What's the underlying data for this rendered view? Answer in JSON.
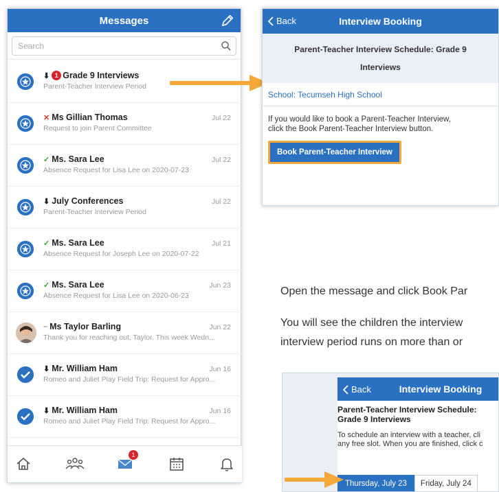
{
  "messages_screen": {
    "title": "Messages",
    "search_placeholder": "Search",
    "items": [
      {
        "prefix": "⬇",
        "badge": "1",
        "name": "Grade 9 Interviews",
        "preview": "Parent-Teacher Interview Period",
        "date": ""
      },
      {
        "prefix": "✕",
        "badge": "",
        "name": "Ms Gillian Thomas",
        "preview": "Request to join Parent Committee",
        "date": "Jul 22"
      },
      {
        "prefix": "✓",
        "badge": "",
        "name": "Ms. Sara Lee",
        "preview": "Absence Request for Lisa Lee on 2020-07-23",
        "date": "Jul 22"
      },
      {
        "prefix": "⬇",
        "badge": "",
        "name": "July Conferences",
        "preview": "Parent-Teacher Interview Period",
        "date": "Jul 22"
      },
      {
        "prefix": "✓",
        "badge": "",
        "name": "Ms. Sara Lee",
        "preview": "Absence Request for Joseph Lee on 2020-07-22",
        "date": "Jul 21"
      },
      {
        "prefix": "✓",
        "badge": "",
        "name": "Ms. Sara Lee",
        "preview": "Absence Request for Lisa Lee on 2020-06-23",
        "date": "Jun 23"
      },
      {
        "prefix": "–",
        "badge": "",
        "name": "Ms Taylor Barling",
        "preview": "Thank you for reaching out, Taylor. This week Wedn...",
        "date": "Jun 22"
      },
      {
        "prefix": "⬇",
        "badge": "",
        "name": "Mr. William Ham",
        "preview": "Romeo and Juliet Play Field Trip: Request for Appro...",
        "date": "Jun 16"
      },
      {
        "prefix": "⬇",
        "badge": "",
        "name": "Mr. William Ham",
        "preview": "Romeo and Juliet Play Field Trip: Request for Appro...",
        "date": "Jun 16"
      }
    ],
    "tab_badge": "1"
  },
  "booking_screen": {
    "back_label": "Back",
    "title": "Interview Booking",
    "schedule_heading_line1": "Parent-Teacher Interview Schedule: Grade 9",
    "schedule_heading_line2": "Interviews",
    "school_link": "School: Tecumseh High School",
    "instructions_line1": "If you would like to book a Parent-Teacher Interview,",
    "instructions_line2": "click the Book Parent-Teacher Interview button.",
    "book_button": "Book Parent-Teacher Interview"
  },
  "body_text": {
    "line1": "Open the message and click Book Par",
    "line2": "You will see the children the interview",
    "line3": "interview period runs on more than or"
  },
  "schedule_screen": {
    "back_label": "Back",
    "title": "Interview Booking",
    "heading_line1": "Parent-Teacher Interview Schedule:",
    "heading_line2": "Grade 9 Interviews",
    "desc_line1": "To schedule an interview with a teacher, cli",
    "desc_line2": "any free slot. When you are finished, click c",
    "day1": "Thursday, July 23",
    "day2": "Friday, July 24"
  },
  "colors": {
    "brand_blue": "#2b71c2",
    "highlight_orange": "#f4a93a",
    "badge_red": "#d8232a"
  }
}
